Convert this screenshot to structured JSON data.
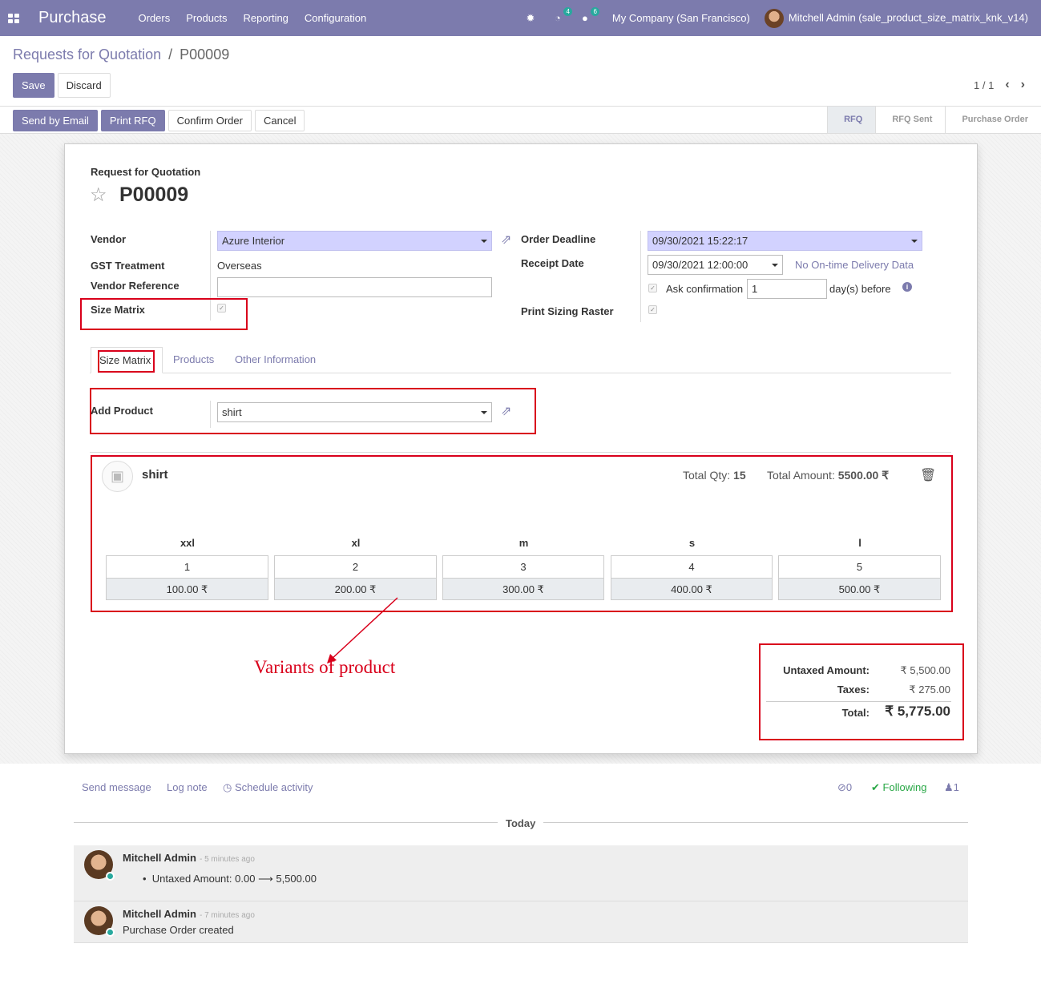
{
  "navbar": {
    "brand": "Purchase",
    "menu": [
      "Orders",
      "Products",
      "Reporting",
      "Configuration"
    ],
    "activity_count": "4",
    "message_count": "6",
    "company": "My Company (San Francisco)",
    "user": "Mitchell Admin (sale_product_size_matrix_knk_v14)"
  },
  "breadcrumb": {
    "parent": "Requests for Quotation",
    "separator": "/",
    "current": "P00009"
  },
  "buttons": {
    "save": "Save",
    "discard": "Discard",
    "send_email": "Send by Email",
    "print_rfq": "Print RFQ",
    "confirm": "Confirm Order",
    "cancel": "Cancel"
  },
  "pager": {
    "value": "1 / 1"
  },
  "status_steps": [
    "RFQ",
    "RFQ Sent",
    "Purchase Order"
  ],
  "form": {
    "doc_type": "Request for Quotation",
    "name": "P00009",
    "vendor_label": "Vendor",
    "vendor": "Azure Interior",
    "gst_label": "GST Treatment",
    "gst": "Overseas",
    "vendor_ref_label": "Vendor Reference",
    "vendor_ref": "",
    "size_matrix_label": "Size Matrix",
    "size_matrix_checked": true,
    "deadline_label": "Order Deadline",
    "deadline": "09/30/2021 15:22:17",
    "receipt_label": "Receipt Date",
    "receipt": "09/30/2021 12:00:00",
    "no_ontime": "No On-time Delivery Data",
    "ask_confirm_label": "Ask confirmation",
    "ask_confirm_days": "1",
    "days_before": "day(s) before",
    "print_raster_label": "Print Sizing Raster",
    "print_raster_checked": true
  },
  "tabs": [
    "Size Matrix",
    "Products",
    "Other Information"
  ],
  "matrix": {
    "add_product_label": "Add Product",
    "add_product_value": "shirt",
    "product_name": "shirt",
    "total_qty_label": "Total Qty:",
    "total_qty": "15",
    "total_amount_label": "Total Amount:",
    "total_amount": "5500.00 ₹",
    "sizes": [
      {
        "name": "xxl",
        "qty": "1",
        "amount": "100.00 ₹"
      },
      {
        "name": "xl",
        "qty": "2",
        "amount": "200.00 ₹"
      },
      {
        "name": "m",
        "qty": "3",
        "amount": "300.00 ₹"
      },
      {
        "name": "s",
        "qty": "4",
        "amount": "400.00 ₹"
      },
      {
        "name": "l",
        "qty": "5",
        "amount": "500.00 ₹"
      }
    ]
  },
  "annotation": "Variants of product",
  "totals": {
    "untaxed_label": "Untaxed Amount:",
    "untaxed": "₹ 5,500.00",
    "taxes_label": "Taxes:",
    "taxes": "₹ 275.00",
    "total_label": "Total:",
    "total": "₹ 5,775.00"
  },
  "chatter": {
    "send_message": "Send message",
    "log_note": "Log note",
    "schedule": "Schedule activity",
    "attachments": "0",
    "following": "Following",
    "followers": "1",
    "today": "Today",
    "messages": [
      {
        "author": "Mitchell Admin",
        "time": "- 5 minutes ago",
        "body_label": "Untaxed Amount:",
        "old": "0.00",
        "new": "5,500.00"
      },
      {
        "author": "Mitchell Admin",
        "time": "- 7 minutes ago",
        "body": "Purchase Order created"
      }
    ]
  },
  "colors": {
    "brand": "#7c7bad",
    "annotation_red": "#d9001b",
    "teal": "#28a99e"
  }
}
